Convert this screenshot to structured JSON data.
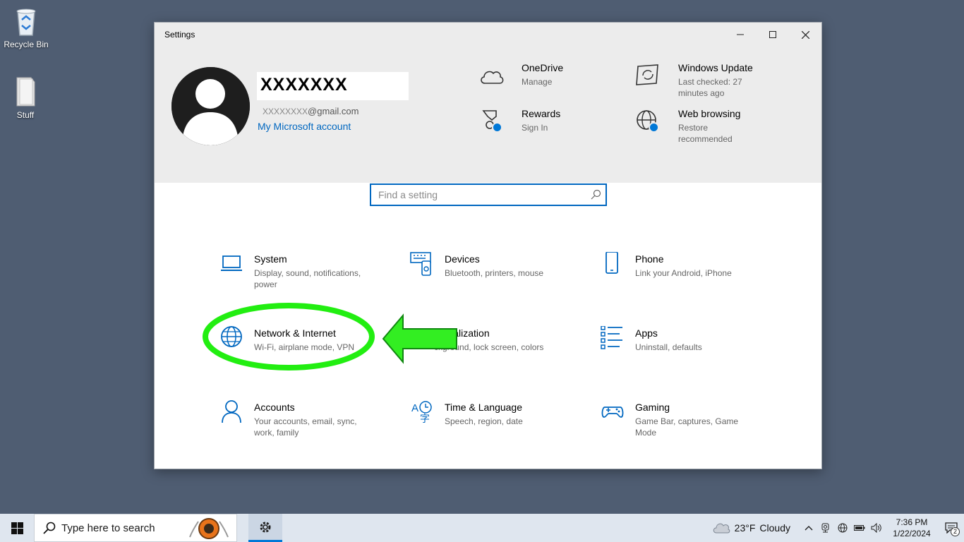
{
  "desktop": {
    "icons": [
      {
        "label": "Recycle Bin",
        "icon": "recycle-bin-icon"
      },
      {
        "label": "Stuff",
        "icon": "folder-icon"
      }
    ]
  },
  "window": {
    "title": "Settings",
    "controls": {
      "minimize": "minimize-icon",
      "maximize": "maximize-icon",
      "close": "close-icon"
    }
  },
  "account": {
    "name": "XXXXXXX",
    "email_masked": "XXXXXXXX",
    "email_domain": "@gmail.com",
    "link": "My Microsoft account"
  },
  "header_items": [
    {
      "title": "OneDrive",
      "subtitle": "Manage",
      "icon": "cloud-icon"
    },
    {
      "title": "Rewards",
      "subtitle": "Sign In",
      "icon": "trophy-icon"
    },
    {
      "title": "Windows Update",
      "subtitle": "Last checked: 27 minutes ago",
      "icon": "update-icon"
    },
    {
      "title": "Web browsing",
      "subtitle": "Restore recommended",
      "icon": "globe-icon"
    }
  ],
  "search": {
    "placeholder": "Find a setting"
  },
  "categories": [
    {
      "name": "System",
      "desc": "Display, sound, notifications, power",
      "icon": "laptop-icon"
    },
    {
      "name": "Devices",
      "desc": "Bluetooth, printers, mouse",
      "icon": "devices-icon"
    },
    {
      "name": "Phone",
      "desc": "Link your Android, iPhone",
      "icon": "phone-icon"
    },
    {
      "name": "Network & Internet",
      "desc": "Wi-Fi, airplane mode, VPN",
      "icon": "globe-icon"
    },
    {
      "name": "rsonalization",
      "desc": "ckground, lock screen, colors",
      "icon": "personalization-icon"
    },
    {
      "name": "Apps",
      "desc": "Uninstall, defaults",
      "icon": "apps-list-icon"
    },
    {
      "name": "Accounts",
      "desc": "Your accounts, email, sync, work, family",
      "icon": "person-icon"
    },
    {
      "name": "Time & Language",
      "desc": "Speech, region, date",
      "icon": "time-language-icon"
    },
    {
      "name": "Gaming",
      "desc": "Game Bar, captures, Game Mode",
      "icon": "gamepad-icon"
    }
  ],
  "annotation": {
    "highlight_color": "#22ee11",
    "target": "Network & Internet"
  },
  "taskbar": {
    "search_placeholder": "Type here to search",
    "weather_temp": "23°F",
    "weather_desc": "Cloudy",
    "time": "7:36 PM",
    "date": "1/22/2024",
    "notification_count": "2"
  }
}
